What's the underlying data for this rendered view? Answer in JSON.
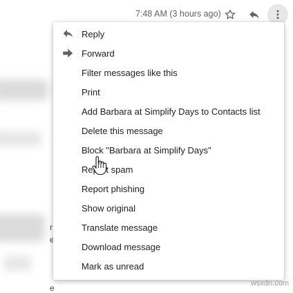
{
  "header": {
    "timestamp": "7:48 AM (3 hours ago)",
    "icons": {
      "star": "star-icon",
      "reply": "reply-icon",
      "more": "more-vert-icon"
    }
  },
  "menu": {
    "items": [
      {
        "label": "Reply",
        "icon": "reply-icon"
      },
      {
        "label": "Forward",
        "icon": "forward-icon"
      },
      {
        "label": "Filter messages like this"
      },
      {
        "label": "Print"
      },
      {
        "label": "Add Barbara at Simplify Days to Contacts list"
      },
      {
        "label": "Delete this message"
      },
      {
        "label": "Block \"Barbara at Simplify Days\""
      },
      {
        "label": "Report spam"
      },
      {
        "label": "Report phishing"
      },
      {
        "label": "Show original"
      },
      {
        "label": "Translate message"
      },
      {
        "label": "Download message"
      },
      {
        "label": "Mark as unread"
      }
    ]
  },
  "background_fragments": [
    "r",
    "e",
    "e"
  ],
  "watermark": "wsxdn.com",
  "colors": {
    "icon_gray": "#5f6368",
    "text": "#202124",
    "hover_circle": "#e8e8e8"
  }
}
